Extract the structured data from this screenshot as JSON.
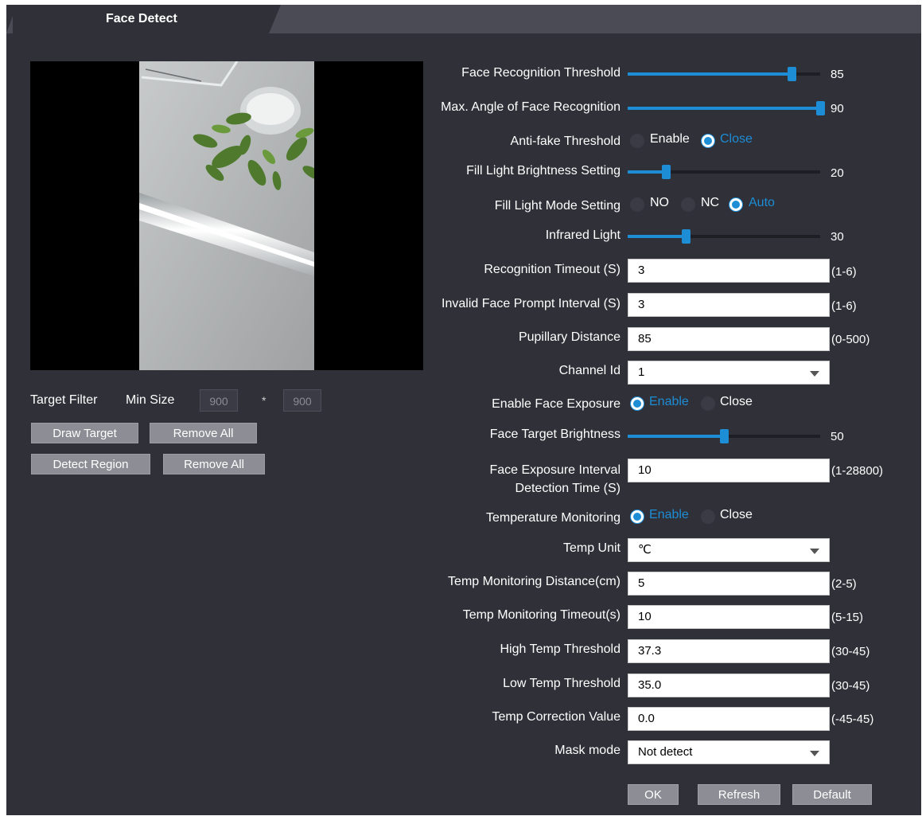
{
  "tab": {
    "label": "Face Detect"
  },
  "left": {
    "target_filter_label": "Target Filter",
    "min_size_label": "Min Size",
    "min_w": "900",
    "times": "*",
    "min_h": "900",
    "draw_target": "Draw Target",
    "remove_all_1": "Remove All",
    "detect_region": "Detect Region",
    "remove_all_2": "Remove All"
  },
  "settings": {
    "face_rec_threshold": {
      "label": "Face Recognition Threshold",
      "value": "85",
      "fraction": 0.85
    },
    "max_angle": {
      "label": "Max. Angle of Face Recognition",
      "value": "90",
      "fraction": 1.0
    },
    "anti_fake": {
      "label": "Anti-fake Threshold",
      "opt1": "Enable",
      "opt2": "Close",
      "selected": "Close"
    },
    "fill_light_brightness": {
      "label": "Fill Light Brightness Setting",
      "value": "20",
      "fraction": 0.2
    },
    "fill_light_mode": {
      "label": "Fill Light Mode Setting",
      "opt1": "NO",
      "opt2": "NC",
      "opt3": "Auto",
      "selected": "Auto"
    },
    "infrared_light": {
      "label": "Infrared Light",
      "value": "30",
      "fraction": 0.3
    },
    "recognition_timeout": {
      "label": "Recognition Timeout (S)",
      "value": "3",
      "range": "(1-6)"
    },
    "invalid_face_interval": {
      "label": "Invalid Face Prompt Interval (S)",
      "value": "3",
      "range": "(1-6)"
    },
    "pupillary_distance": {
      "label": "Pupillary Distance",
      "value": "85",
      "range": "(0-500)"
    },
    "channel_id": {
      "label": "Channel Id",
      "value": "1"
    },
    "enable_face_exposure": {
      "label": "Enable Face Exposure",
      "opt1": "Enable",
      "opt2": "Close",
      "selected": "Enable"
    },
    "face_target_brightness": {
      "label": "Face Target Brightness",
      "value": "50",
      "fraction": 0.5
    },
    "face_exposure_interval": {
      "label_line1": "Face Exposure Interval",
      "label_line2": "Detection Time (S)",
      "value": "10",
      "range": "(1-28800)"
    },
    "temp_monitoring": {
      "label": "Temperature Monitoring",
      "opt1": "Enable",
      "opt2": "Close",
      "selected": "Enable"
    },
    "temp_unit": {
      "label": "Temp Unit",
      "value": "℃"
    },
    "temp_distance": {
      "label": "Temp Monitoring Distance(cm)",
      "value": "5",
      "range": "(2-5)"
    },
    "temp_timeout": {
      "label": "Temp Monitoring Timeout(s)",
      "value": "10",
      "range": "(5-15)"
    },
    "high_temp": {
      "label": "High Temp Threshold",
      "value": "37.3",
      "range": "(30-45)"
    },
    "low_temp": {
      "label": "Low Temp Threshold",
      "value": "35.0",
      "range": "(30-45)"
    },
    "temp_correction": {
      "label": "Temp Correction Value",
      "value": "0.0",
      "range": "(-45-45)"
    },
    "mask_mode": {
      "label": "Mask mode",
      "value": "Not detect"
    }
  },
  "footer": {
    "ok": "OK",
    "refresh": "Refresh",
    "default": "Default"
  },
  "colors": {
    "accent": "#1d8dd6",
    "panel": "#2f3038",
    "tabbar": "#4a4b55"
  }
}
